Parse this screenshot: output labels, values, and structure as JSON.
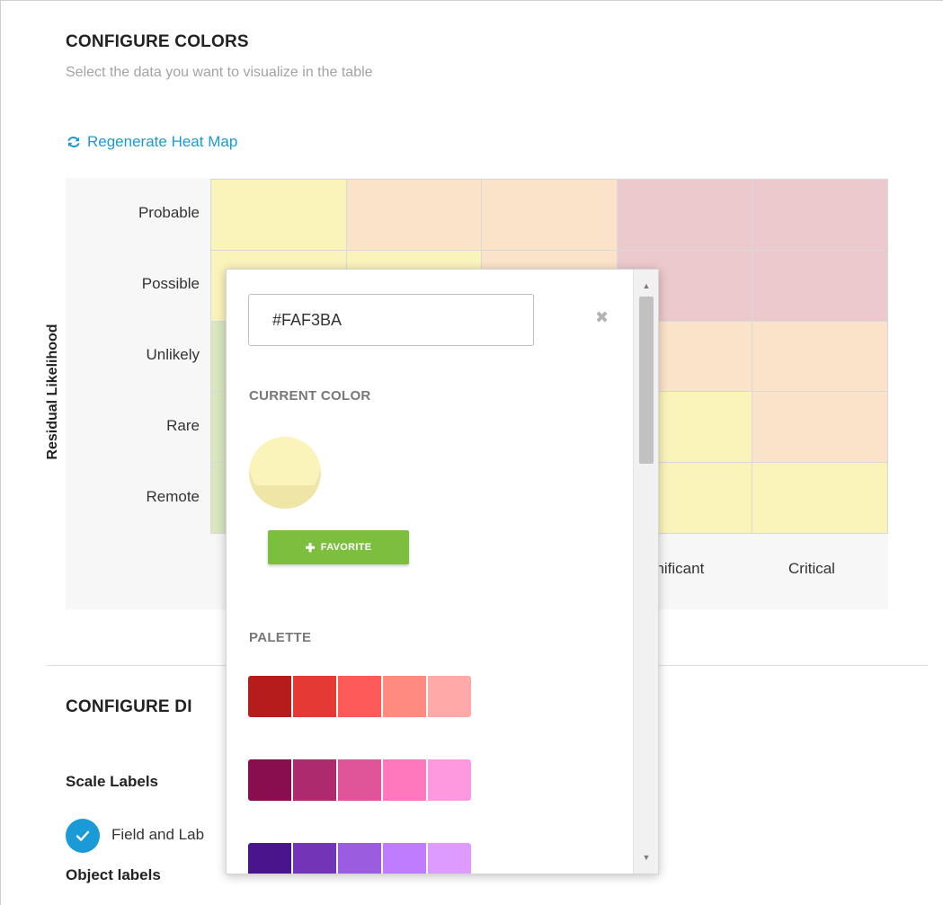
{
  "colors_section": {
    "title": "CONFIGURE COLORS",
    "subtitle": "Select the data you want to visualize in the table",
    "regenerate_label": "Regenerate Heat Map",
    "accent_color": "#1a9ad6"
  },
  "heatmap": {
    "y_axis_label": "Residual Likelihood",
    "rows": [
      "Probable",
      "Possible",
      "Unlikely",
      "Rare",
      "Remote"
    ],
    "visible_columns": [
      "gnificant",
      "Critical"
    ],
    "cells": [
      [
        "#FAF3BA",
        "#FAE3C9",
        "#FAE3C9",
        "#ECC9CC",
        "#ECC9CC"
      ],
      [
        "#FAF3BA",
        "#FAF3BA",
        "#FAE3C9",
        "#ECC9CC",
        "#ECC9CC"
      ],
      [
        "#D8E7BF",
        "#FAF3BA",
        "#FAF3BA",
        "#FAE3C9",
        "#FAE3C9"
      ],
      [
        "#D8E7BF",
        "#D8E7BF",
        "#FAF3BA",
        "#FAF3BA",
        "#FAE3C9"
      ],
      [
        "#D8E7BF",
        "#D8E7BF",
        "#FAF3BA",
        "#FAF3BA",
        "#FAF3BA"
      ]
    ]
  },
  "display_section": {
    "title": "CONFIGURE DI",
    "scale_labels_title": "Scale Labels",
    "field_label_option": "Field and Lab",
    "object_labels_title": "Object labels"
  },
  "color_picker": {
    "hex_value": "#FAF3BA",
    "current_color_label": "CURRENT COLOR",
    "current_color": "#FAF3BA",
    "favorite_label": "FAVORITE",
    "palette_label": "PALETTE",
    "palette": [
      [
        "#B71C1C",
        "#E53935",
        "#FF5A5A",
        "#FF8A80",
        "#FFAAA8"
      ],
      [
        "#880E4F",
        "#AD2A6F",
        "#E0549A",
        "#FF77BD",
        "#FF99DF"
      ],
      [
        "#4A148C",
        "#7434B8",
        "#9C5CE0",
        "#BF7CFF",
        "#DE9BFF"
      ]
    ]
  }
}
